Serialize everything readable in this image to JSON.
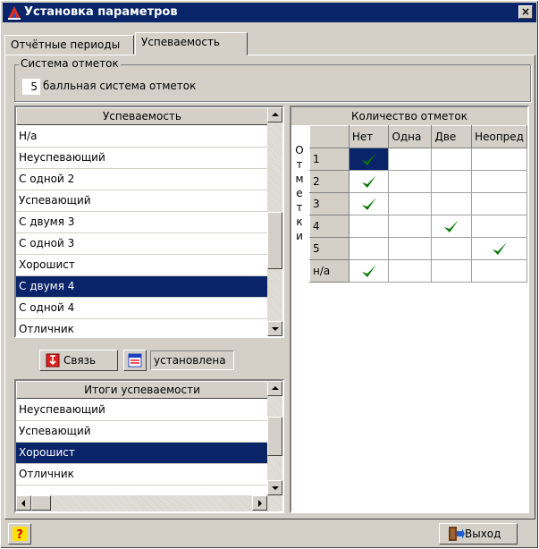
{
  "window": {
    "title": "Установка параметров",
    "close_symbol": "×"
  },
  "tabs": [
    {
      "label": "Отчётные периоды",
      "active": false
    },
    {
      "label": "Успеваемость",
      "active": true
    }
  ],
  "grading": {
    "group_label": "Система отметок",
    "value": "5",
    "description": "балльная система отметок"
  },
  "performance_list": {
    "header": "Успеваемость",
    "items": [
      "Н/а",
      "Неуспевающий",
      "С одной 2",
      "Успевающий",
      "С двумя 3",
      "С одной 3",
      "Хорошист",
      "С двумя 4",
      "С одной 4",
      "Отличник"
    ],
    "selected_index": 7
  },
  "link_controls": {
    "link_button_label": "Связь",
    "status_text": "установлена"
  },
  "summary_list": {
    "header": "Итоги успеваемости",
    "items": [
      "Неуспевающий",
      "Успевающий",
      "Хорошист",
      "Отличник"
    ],
    "selected_index": 2
  },
  "grades_grid": {
    "title": "Количество отметок",
    "side_label": [
      "О",
      "т",
      "м",
      "е",
      "т",
      "к",
      "и"
    ],
    "columns": [
      "Нет",
      "Одна",
      "Две",
      "Неопред"
    ],
    "rows": [
      {
        "label": "1",
        "checks": [
          true,
          false,
          false,
          false
        ]
      },
      {
        "label": "2",
        "checks": [
          true,
          false,
          false,
          false
        ]
      },
      {
        "label": "3",
        "checks": [
          true,
          false,
          false,
          false
        ]
      },
      {
        "label": "4",
        "checks": [
          false,
          false,
          true,
          false
        ]
      },
      {
        "label": "5",
        "checks": [
          false,
          false,
          false,
          true
        ]
      },
      {
        "label": "н/а",
        "checks": [
          true,
          false,
          false,
          false
        ]
      }
    ]
  },
  "footer": {
    "help_symbol": "?",
    "exit_label": "Выход"
  },
  "colors": {
    "selection": "#0a246a",
    "check": "#0a7a0a",
    "face": "#d4d0c8"
  }
}
